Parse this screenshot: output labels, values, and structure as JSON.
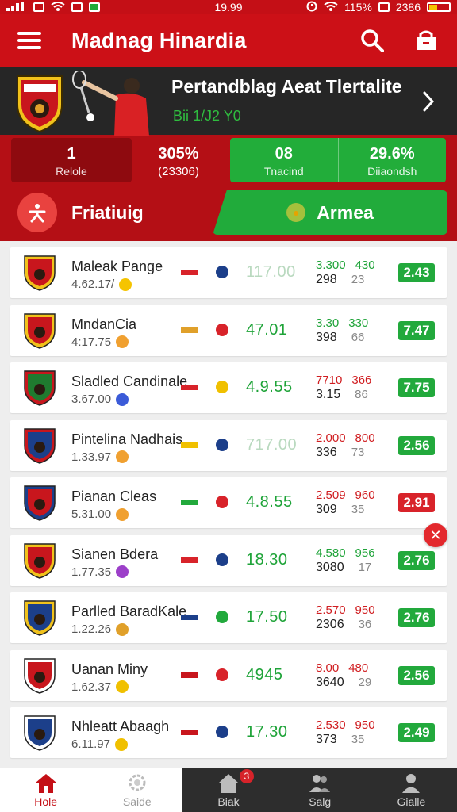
{
  "status_bar": {
    "time": "19.99",
    "battery": "115%",
    "extra": "2386"
  },
  "app_bar": {
    "title": "Madnag Hinardia",
    "search_icon": "search-icon",
    "store_icon": "store-icon"
  },
  "hero": {
    "title": "Pertandblag Aeat Tlertalite",
    "subtitle": "Bii 1/J2 Y0",
    "stats": {
      "left": {
        "value": "1",
        "label": "Relole"
      },
      "mid": {
        "value": "305%",
        "label": "(23306)"
      },
      "green1": {
        "value": "08",
        "label": "Tnacind"
      },
      "green2": {
        "value": "29.6%",
        "label": "Diiaondsh"
      }
    },
    "action_label": "Friatiuig",
    "armea_label": "Armea"
  },
  "rows": [
    {
      "name": "Maleak Pange",
      "sub": "4.62.17/",
      "value": "117.00",
      "value_color": "pale",
      "odds_top": [
        "3.300",
        "430"
      ],
      "odds_top_color": "green",
      "odds_bot": [
        "298",
        "23"
      ],
      "badge": "2.43",
      "badge_color": "green"
    },
    {
      "name": "MndanCia",
      "sub": "4:17.75",
      "value": "47.01",
      "value_color": "green",
      "odds_top": [
        "3.30",
        "330"
      ],
      "odds_top_color": "green",
      "odds_bot": [
        "398",
        "66"
      ],
      "badge": "7.47",
      "badge_color": "green"
    },
    {
      "name": "Sladled Candinale",
      "sub": "3.67.00",
      "value": "4.9.55",
      "value_color": "green",
      "odds_top": [
        "7710",
        "366"
      ],
      "odds_top_color": "red",
      "odds_bot": [
        "3.15",
        "86"
      ],
      "badge": "7.75",
      "badge_color": "green"
    },
    {
      "name": "Pintelina Nadhais",
      "sub": "1.33.97",
      "value": "717.00",
      "value_color": "pale",
      "odds_top": [
        "2.000",
        "800"
      ],
      "odds_top_color": "red",
      "odds_bot": [
        "336",
        "73"
      ],
      "badge": "2.56",
      "badge_color": "green"
    },
    {
      "name": "Pianan Cleas",
      "sub": "5.31.00",
      "value": "4.8.55",
      "value_color": "green",
      "odds_top": [
        "2.509",
        "960"
      ],
      "odds_top_color": "red",
      "odds_bot": [
        "309",
        "35"
      ],
      "badge": "2.91",
      "badge_color": "red"
    },
    {
      "name": "Sianen Bdera",
      "sub": "1.77.35",
      "value": "18.30",
      "value_color": "green",
      "odds_top": [
        "4.580",
        "956"
      ],
      "odds_top_color": "green",
      "odds_bot": [
        "3080",
        "17"
      ],
      "badge": "2.76",
      "badge_color": "green"
    },
    {
      "name": "Parlled BaradKale",
      "sub": "1.22.26",
      "value": "17.50",
      "value_color": "green",
      "odds_top": [
        "2.570",
        "950"
      ],
      "odds_top_color": "red",
      "odds_bot": [
        "2306",
        "36"
      ],
      "badge": "2.76",
      "badge_color": "green"
    },
    {
      "name": "Uanan Miny",
      "sub": "1.62.37",
      "value": "4945",
      "value_color": "green",
      "odds_top": [
        "8.00",
        "480"
      ],
      "odds_top_color": "red",
      "odds_bot": [
        "3640",
        "29"
      ],
      "badge": "2.56",
      "badge_color": "green"
    },
    {
      "name": "Nhleatt Abaagh",
      "sub": "6.11.97",
      "value": "17.30",
      "value_color": "green",
      "odds_top": [
        "2.530",
        "950"
      ],
      "odds_top_color": "red",
      "odds_bot": [
        "373",
        "35"
      ],
      "badge": "2.49",
      "badge_color": "green"
    }
  ],
  "bottom_nav": [
    {
      "label": "Hole",
      "icon": "home-icon"
    },
    {
      "label": "Saide",
      "icon": "gear-icon"
    },
    {
      "label": "Biak",
      "icon": "house-icon",
      "badge": "3"
    },
    {
      "label": "Salg",
      "icon": "people-icon"
    },
    {
      "label": "Gialle",
      "icon": "profile-icon"
    }
  ],
  "colors": {
    "primary_red": "#cc1017",
    "accent_green": "#22ad3a",
    "dark": "#2d2d2d"
  }
}
